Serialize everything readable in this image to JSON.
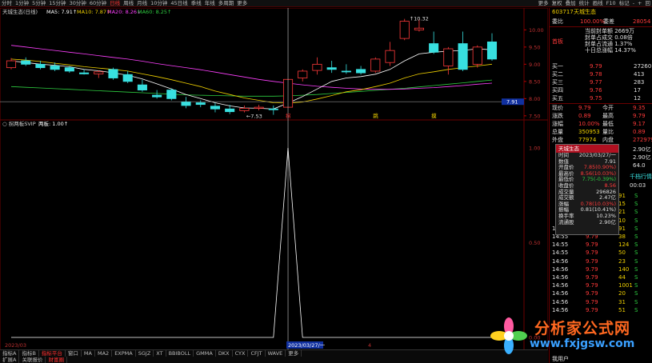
{
  "toolbar": {
    "items": [
      "分时",
      "1分钟",
      "5分钟",
      "15分钟",
      "30分钟",
      "60分钟",
      "日线",
      "周线",
      "月线",
      "10分钟",
      "45日线",
      "季线",
      "年线",
      "多周期",
      "更多"
    ],
    "right": [
      "更多",
      "复权",
      "叠加",
      "统计",
      "画线",
      "F10",
      "标记",
      "-",
      "+",
      "回"
    ],
    "active_index": 6
  },
  "main_panel": {
    "title": "天城生态(日线)",
    "ma_labels": [
      {
        "text": "MA5: 7.91↑",
        "color": "#ffffff"
      },
      {
        "text": "MA10: 7.87↑",
        "color": "#f0d000"
      },
      {
        "text": "MA20: 8.26↓",
        "color": "#ff40ff"
      },
      {
        "text": "MA60: 8.25↑",
        "color": "#2ecc40"
      }
    ],
    "price_labels": [
      "10.00",
      "9.50",
      "9.00",
      "8.50",
      "8.00",
      "7.50"
    ],
    "high_annotation": "10.32",
    "low_annotation": "7.53",
    "current_price_tag": "7.91",
    "markers": [
      {
        "text": "拐",
        "color": "#ff3030"
      },
      {
        "text": "跳",
        "color": "#f0d000"
      },
      {
        "text": "摸",
        "color": "#f0d000"
      }
    ]
  },
  "indicator_panel": {
    "title": "拐两板SVIP",
    "value_label": "两板: 1.00↑",
    "value_labels": [
      "1.00",
      "0.50",
      "0.00"
    ],
    "date_left": "2023/03",
    "date_cursor": "2023/03/27/一",
    "date_right": "4"
  },
  "chart_data": {
    "type": "candlestick",
    "candles": [
      [
        8.9,
        9.18,
        8.85,
        9.1
      ],
      [
        9.1,
        9.2,
        8.95,
        9.0
      ],
      [
        9.0,
        9.1,
        8.85,
        8.9
      ],
      [
        8.95,
        9.05,
        8.8,
        8.85
      ],
      [
        8.9,
        8.95,
        8.75,
        8.8
      ],
      [
        8.75,
        8.85,
        8.7,
        8.72
      ],
      [
        8.72,
        8.82,
        8.6,
        8.78
      ],
      [
        8.85,
        8.9,
        8.55,
        8.6
      ],
      [
        8.7,
        8.8,
        8.45,
        8.5
      ],
      [
        8.4,
        8.55,
        8.2,
        8.25
      ],
      [
        8.1,
        8.25,
        8.0,
        8.05
      ],
      [
        8.25,
        8.3,
        7.95,
        8.0
      ],
      [
        7.9,
        8.05,
        7.72,
        7.8
      ],
      [
        7.88,
        7.95,
        7.75,
        7.83
      ],
      [
        7.78,
        7.88,
        7.6,
        7.7
      ],
      [
        7.7,
        7.82,
        7.55,
        7.62
      ],
      [
        7.65,
        7.8,
        7.6,
        7.72
      ],
      [
        7.72,
        7.82,
        7.66,
        7.75
      ],
      [
        7.7,
        7.8,
        7.53,
        7.68
      ],
      [
        7.75,
        8.56,
        7.75,
        8.56
      ],
      [
        8.6,
        8.85,
        8.5,
        8.8
      ],
      [
        8.82,
        9.2,
        8.7,
        9.0
      ],
      [
        8.9,
        9.1,
        8.75,
        8.85
      ],
      [
        8.8,
        9.0,
        8.72,
        8.78
      ],
      [
        8.85,
        8.95,
        8.7,
        8.75
      ],
      [
        8.8,
        9.2,
        8.75,
        9.15
      ],
      [
        9.05,
        9.65,
        8.95,
        9.4
      ],
      [
        9.75,
        10.32,
        9.7,
        10.25
      ],
      [
        10.0,
        10.3,
        9.95,
        10.05
      ],
      [
        9.6,
        9.95,
        9.3,
        9.35
      ],
      [
        8.95,
        9.5,
        8.7,
        9.45
      ],
      [
        9.6,
        9.95,
        8.8,
        8.85
      ],
      [
        9.0,
        9.55,
        8.9,
        9.5
      ],
      [
        9.65,
        9.9,
        9.1,
        9.15
      ]
    ],
    "ma5": [
      9.1,
      9.05,
      9.0,
      8.97,
      8.93,
      8.85,
      8.81,
      8.75,
      8.68,
      8.57,
      8.43,
      8.28,
      8.12,
      8.0,
      7.88,
      7.79,
      7.73,
      7.72,
      7.7,
      7.87,
      8.06,
      8.28,
      8.5,
      8.6,
      8.64,
      8.71,
      8.85,
      9.1,
      9.3,
      9.35,
      9.38,
      9.4,
      9.45,
      9.42
    ],
    "ma10": [
      9.15,
      9.12,
      9.08,
      9.03,
      8.98,
      8.93,
      8.89,
      8.85,
      8.8,
      8.72,
      8.64,
      8.55,
      8.45,
      8.35,
      8.22,
      8.12,
      8.02,
      7.95,
      7.88,
      7.87,
      7.9,
      7.99,
      8.09,
      8.2,
      8.26,
      8.35,
      8.45,
      8.6,
      8.72,
      8.78,
      8.85,
      8.9,
      8.95,
      9.0
    ],
    "ma20": [
      9.55,
      9.5,
      9.45,
      9.4,
      9.35,
      9.3,
      9.25,
      9.2,
      9.15,
      9.09,
      9.02,
      8.96,
      8.9,
      8.84,
      8.77,
      8.7,
      8.63,
      8.56,
      8.5,
      8.45,
      8.4,
      8.36,
      8.33,
      8.3,
      8.28,
      8.27,
      8.27,
      8.28,
      8.3,
      8.32,
      8.35,
      8.38,
      8.42,
      8.45
    ],
    "ma60": [
      8.35,
      8.33,
      8.31,
      8.29,
      8.27,
      8.25,
      8.23,
      8.21,
      8.19,
      8.17,
      8.15,
      8.13,
      8.11,
      8.1,
      8.09,
      8.08,
      8.07,
      8.07,
      8.07,
      8.08,
      8.1,
      8.12,
      8.15,
      8.18,
      8.21,
      8.24,
      8.27,
      8.3,
      8.34,
      8.38,
      8.42,
      8.46,
      8.5,
      8.54
    ],
    "price_range": [
      7.45,
      10.45
    ],
    "indicator_values": [
      0,
      0,
      0,
      0,
      0,
      0,
      0,
      0,
      0,
      0,
      0,
      0,
      0,
      0,
      0,
      0,
      0,
      0,
      0,
      1,
      0,
      0,
      0,
      0,
      0,
      0,
      0,
      0,
      0,
      0,
      0,
      0,
      0,
      0
    ],
    "indicator_range": [
      0,
      1.0
    ]
  },
  "right_panel": {
    "code": "603717",
    "name": "天城生态",
    "wei_bi_label": "委比",
    "wei_bi_value": "100.00%",
    "wei_cha_label": "委差",
    "wei_cha_value": "28054",
    "limit_info": [
      "当前封单额 2669万",
      "封单占成交 0.08倍",
      "封单占流通 1.37%",
      "十日总涨幅 14.37%"
    ],
    "shouban": "首板",
    "asks": [
      {
        "label": "卖五",
        "price": "",
        "vol": ""
      },
      {
        "label": "卖四",
        "price": "",
        "vol": ""
      },
      {
        "label": "卖三",
        "price": "",
        "vol": ""
      },
      {
        "label": "卖二",
        "price": "",
        "vol": ""
      },
      {
        "label": "卖一",
        "price": "",
        "vol": ""
      }
    ],
    "bids": [
      {
        "label": "买一",
        "price": "9.79",
        "vol": "27260"
      },
      {
        "label": "买二",
        "price": "9.78",
        "vol": "413"
      },
      {
        "label": "买三",
        "price": "9.77",
        "vol": "283"
      },
      {
        "label": "买四",
        "price": "9.76",
        "vol": "17"
      },
      {
        "label": "买五",
        "price": "9.75",
        "vol": "12"
      }
    ],
    "quote": [
      {
        "l": "现价",
        "v": "9.79",
        "l2": "今开",
        "v2": "9.35"
      },
      {
        "l": "涨跌",
        "v": "0.89",
        "l2": "最高",
        "v2": "9.79"
      },
      {
        "l": "涨幅",
        "v": "10.00%",
        "l2": "最低",
        "v2": "9.17"
      },
      {
        "l": "总量",
        "v": "350953",
        "l2": "量比",
        "v2": "0.89"
      },
      {
        "l": "外盘",
        "v": "77974",
        "l2": "内盘",
        "v2": "272979"
      }
    ],
    "extra": [
      {
        "v": "2.90亿"
      },
      {
        "v": "2.90亿"
      },
      {
        "v": "64.0"
      }
    ],
    "time_now": "00:03",
    "qianzhang": "千档行情",
    "ticks": [
      {
        "t": "",
        "p": "",
        "v": "91",
        "s": "S"
      },
      {
        "t": "",
        "p": "",
        "v": "15",
        "s": "S"
      },
      {
        "t": "",
        "p": "",
        "v": "21",
        "s": "S"
      },
      {
        "t": "",
        "p": "",
        "v": "10",
        "s": "S"
      },
      {
        "t": "14:55",
        "p": "9.79",
        "v": "91",
        "s": "S"
      },
      {
        "t": "14:55",
        "p": "9.79",
        "v": "38",
        "s": "S"
      },
      {
        "t": "14:55",
        "p": "9.79",
        "v": "124",
        "s": "S"
      },
      {
        "t": "14:55",
        "p": "9.79",
        "v": "50",
        "s": "S"
      },
      {
        "t": "14:56",
        "p": "9.79",
        "v": "23",
        "s": "S"
      },
      {
        "t": "14:56",
        "p": "9.79",
        "v": "140",
        "s": "S"
      },
      {
        "t": "14:56",
        "p": "9.79",
        "v": "44",
        "s": "S"
      },
      {
        "t": "14:56",
        "p": "9.79",
        "v": "1001",
        "s": "S"
      },
      {
        "t": "14:56",
        "p": "9.79",
        "v": "20",
        "s": "S"
      },
      {
        "t": "14:56",
        "p": "9.79",
        "v": "31",
        "s": "S"
      },
      {
        "t": "14:56",
        "p": "9.79",
        "v": "51",
        "s": "S"
      }
    ],
    "footer": "我用户"
  },
  "popup": {
    "title": "天城生态",
    "rows": [
      {
        "l": "时间",
        "v": "2023/03/27/一",
        "c": "#e0e0e0"
      },
      {
        "l": "数值",
        "v": "7.91",
        "c": "#e0e0e0"
      },
      {
        "l": "开盘价",
        "v": "7.85(0.90%)",
        "c": "#ff3a3a"
      },
      {
        "l": "最高价",
        "v": "8.56(10.03%)",
        "c": "#ff3a3a"
      },
      {
        "l": "最低价",
        "v": "7.75(-0.39%)",
        "c": "#2ecc40"
      },
      {
        "l": "收盘价",
        "v": "8.56",
        "c": "#ff3a3a"
      },
      {
        "l": "成交量",
        "v": "296826",
        "c": "#e0e0e0"
      },
      {
        "l": "成交额",
        "v": "2.47亿",
        "c": "#e0e0e0"
      },
      {
        "l": "涨幅",
        "v": "0.78(10.03%)",
        "c": "#ff3a3a"
      },
      {
        "l": "振幅",
        "v": "0.81(10.41%)",
        "c": "#e0e0e0"
      },
      {
        "l": "换手率",
        "v": "10.23%",
        "c": "#e0e0e0"
      },
      {
        "l": "流通股",
        "v": "2.90亿",
        "c": "#e0e0e0"
      }
    ]
  },
  "bottom_bar": {
    "row1": [
      "指标A",
      "指标B",
      "指标平台",
      "窗口",
      "MA",
      "MA2",
      "EXPMA",
      "SGJZ",
      "XT",
      "BBIBOLL",
      "GMMA",
      "DKX",
      "CYX",
      "CFJT",
      "WAVE",
      "更多"
    ],
    "row2": [
      "扩展A",
      "关联报价",
      "财富圈"
    ],
    "active": "指标平台"
  },
  "watermark": {
    "title": "分析家公式网",
    "url": "www.fxjgsw.com"
  }
}
